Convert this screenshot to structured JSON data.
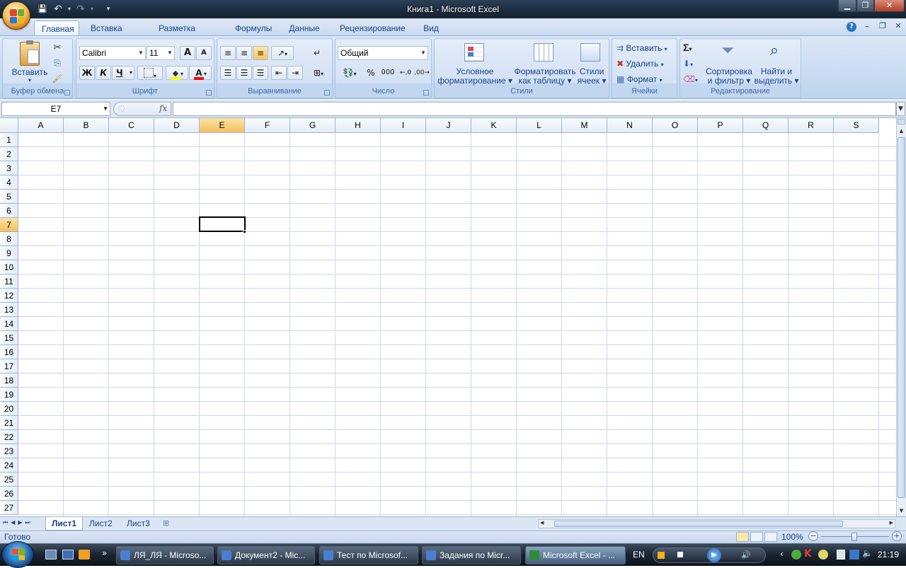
{
  "window": {
    "title": "Книга1 - Microsoft Excel",
    "controls": {
      "minimize": "▁",
      "restore": "❐",
      "close": "✕"
    }
  },
  "qat": {
    "save": "💾",
    "undo": "↶",
    "redo": "↷",
    "customize": "▾"
  },
  "tabs": [
    "Главная",
    "Вставка",
    "Разметка страницы",
    "Формулы",
    "Данные",
    "Рецензирование",
    "Вид"
  ],
  "ribbon_right": {
    "help": "?",
    "min": "–",
    "restore": "❐",
    "close": "✕"
  },
  "clipboard": {
    "label": "Буфер обмена",
    "paste": "Вставить"
  },
  "font": {
    "label": "Шрифт",
    "name": "Calibri",
    "size": "11",
    "grow": "A",
    "shrink": "A",
    "bold": "Ж",
    "italic": "К",
    "underline": "Ч"
  },
  "alignment": {
    "label": "Выравнивание"
  },
  "number": {
    "label": "Число",
    "format": "Общий",
    "percent": "%",
    "thousands": "000",
    ",00": ",00"
  },
  "styles": {
    "label": "Стили",
    "cond_l1": "Условное",
    "cond_l2": "форматирование",
    "table_l1": "Форматировать",
    "table_l2": "как таблицу",
    "cell_l1": "Стили",
    "cell_l2": "ячеек"
  },
  "cells": {
    "label": "Ячейки",
    "insert": "Вставить",
    "delete": "Удалить",
    "format": "Формат"
  },
  "editing": {
    "label": "Редактирование",
    "sum": "Σ",
    "sort_l1": "Сортировка",
    "sort_l2": "и фильтр",
    "find_l1": "Найти и",
    "find_l2": "выделить"
  },
  "formula": {
    "namebox": "E7",
    "fx": "fx",
    "value": ""
  },
  "columns": [
    "A",
    "B",
    "C",
    "D",
    "E",
    "F",
    "G",
    "H",
    "I",
    "J",
    "K",
    "L",
    "M",
    "N",
    "O",
    "P",
    "Q",
    "R",
    "S"
  ],
  "rows": [
    "1",
    "2",
    "3",
    "4",
    "5",
    "6",
    "7",
    "8",
    "9",
    "10",
    "11",
    "12",
    "13",
    "14",
    "15",
    "16",
    "17",
    "18",
    "19",
    "20",
    "21",
    "22",
    "23",
    "24",
    "25",
    "26",
    "27"
  ],
  "selected": {
    "col": "E",
    "row": "7"
  },
  "sheets": [
    "Лист1",
    "Лист2",
    "Лист3"
  ],
  "status": {
    "ready": "Готово",
    "zoom": "100%",
    "minus": "−",
    "plus": "+"
  },
  "taskbar": {
    "items": [
      "ЛЯ_ЛЯ - Microso...",
      "Документ2 - Mic...",
      "Тест по Microsof...",
      "Задания по Micr...",
      "Microsoft Excel - ..."
    ],
    "lang": "EN",
    "clock": "21:19",
    "more": "»"
  }
}
